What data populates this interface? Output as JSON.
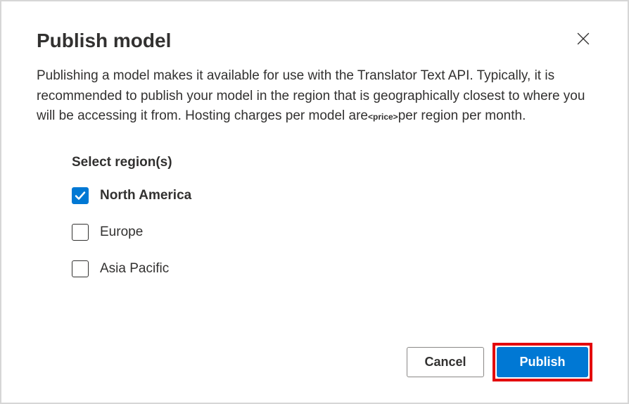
{
  "dialog": {
    "title": "Publish model",
    "description_part1": "Publishing a model makes it available for use with the Translator Text API. Typically, it is recommended to publish your model in the region that is geographically closest to where you will be accessing it from. Hosting charges per model are",
    "price_placeholder": "<price>",
    "description_part2": "per region per month."
  },
  "regions": {
    "label": "Select region(s)",
    "items": [
      {
        "label": "North America",
        "checked": true
      },
      {
        "label": "Europe",
        "checked": false
      },
      {
        "label": "Asia Pacific",
        "checked": false
      }
    ]
  },
  "buttons": {
    "cancel": "Cancel",
    "publish": "Publish"
  },
  "colors": {
    "primary": "#0078d4",
    "highlight_border": "#e3050c"
  }
}
